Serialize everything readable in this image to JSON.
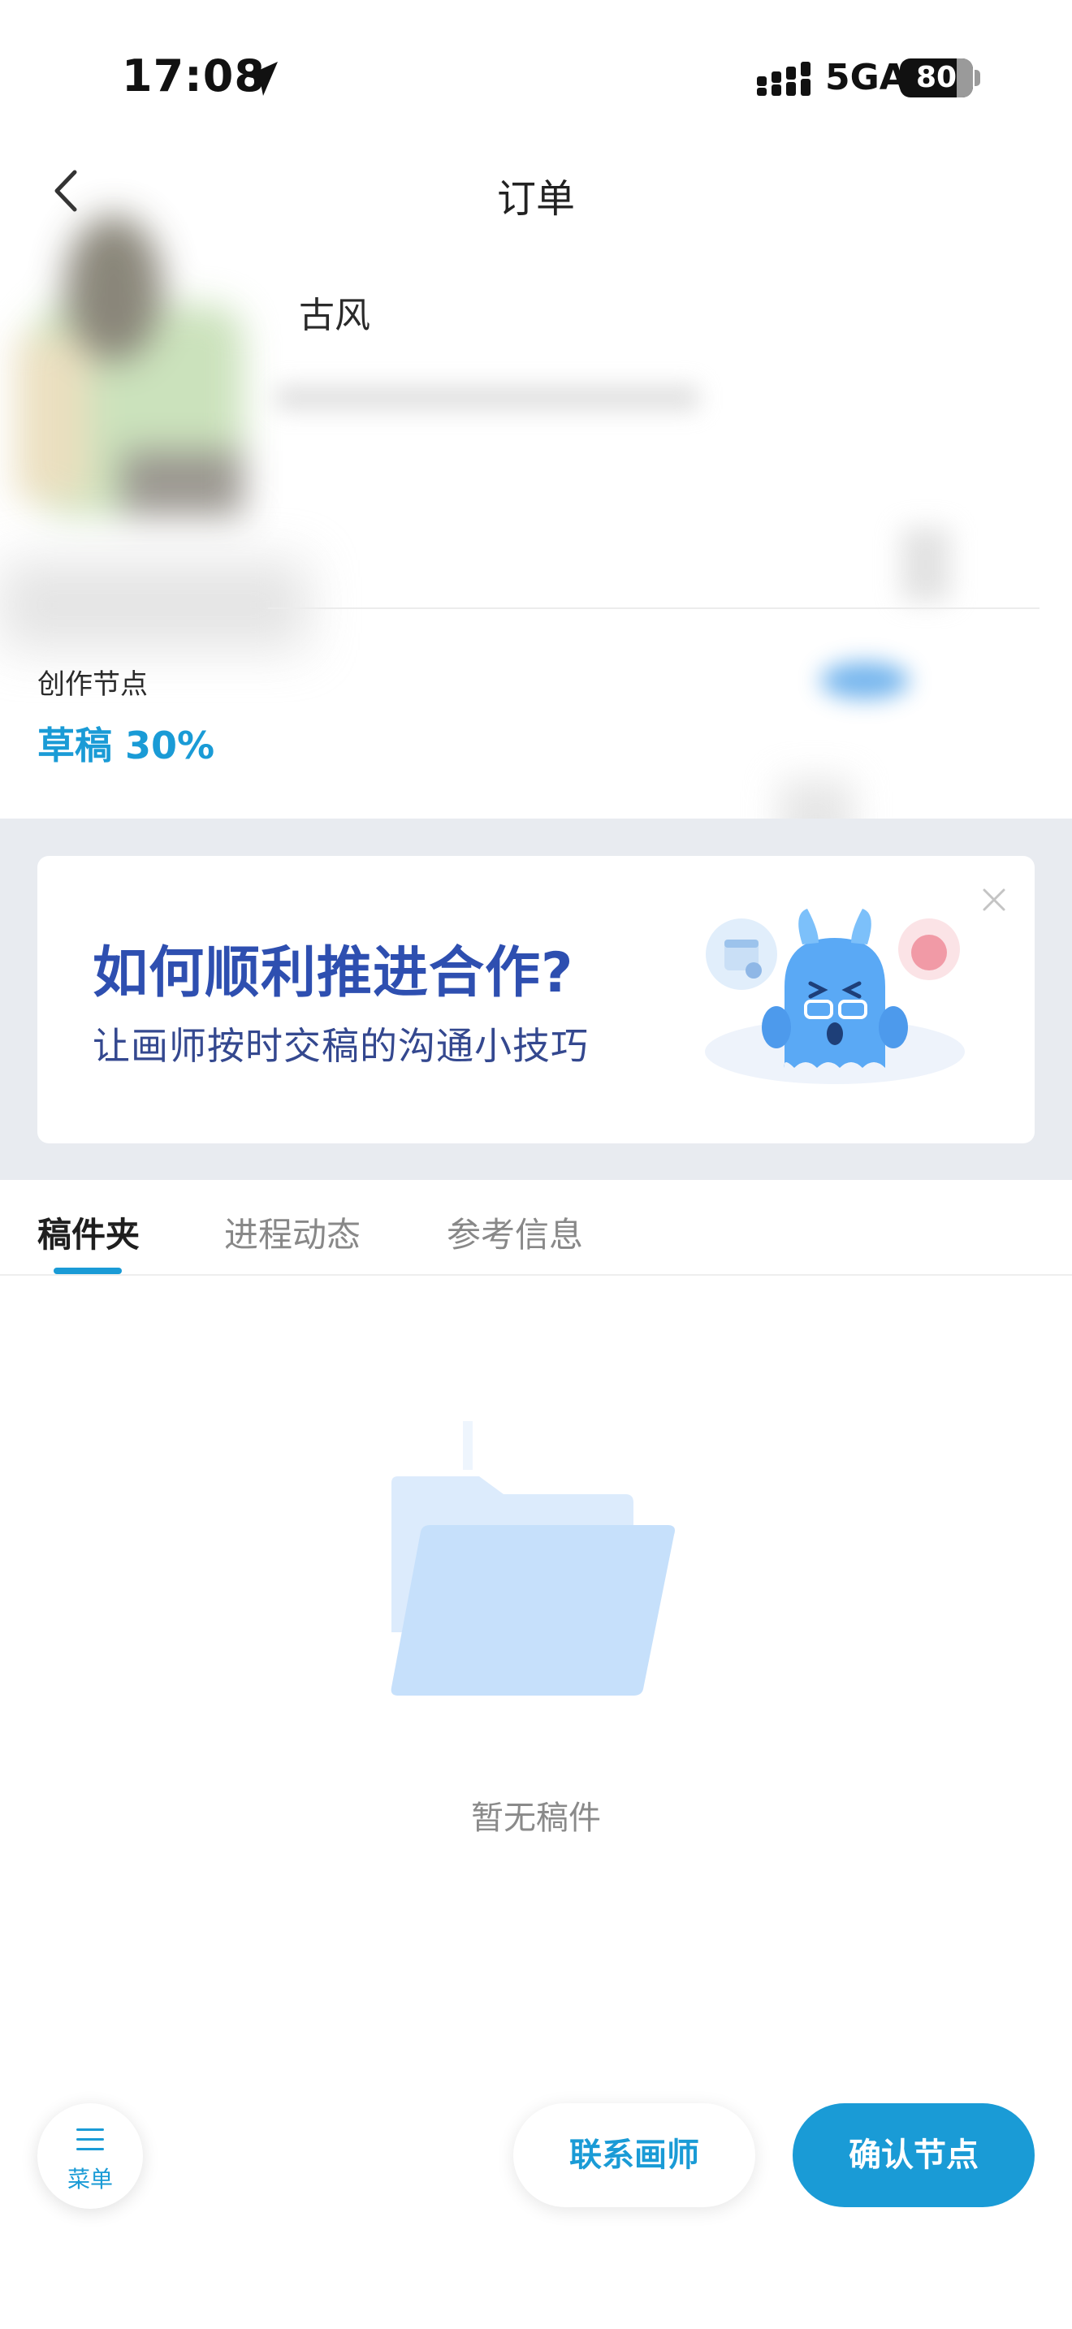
{
  "status_bar": {
    "time": "17:08",
    "network": "5GA",
    "battery": "80",
    "icons": [
      "location-arrow-icon",
      "signal-icon",
      "battery-icon"
    ]
  },
  "nav": {
    "title": "订单",
    "back_icon": "chevron-left-icon"
  },
  "order": {
    "title": "古风"
  },
  "node": {
    "label": "创作节点",
    "value": "草稿 30%"
  },
  "banner": {
    "title": "如何顺利推进合作?",
    "subtitle": "让画师按时交稿的沟通小技巧",
    "close_icon": "close-icon"
  },
  "tabs": [
    {
      "label": "稿件夹",
      "active": true
    },
    {
      "label": "进程动态",
      "active": false
    },
    {
      "label": "参考信息",
      "active": false
    }
  ],
  "empty_state": {
    "text": "暂无稿件",
    "icon": "folder-icon"
  },
  "bottom_bar": {
    "menu_label": "菜单",
    "menu_icon": "menu-icon",
    "contact_label": "联系画师",
    "confirm_label": "确认节点"
  },
  "colors": {
    "accent": "#1a9bd6",
    "banner_title": "#2e4fb0",
    "banner_bg": "#e8ebf0"
  }
}
